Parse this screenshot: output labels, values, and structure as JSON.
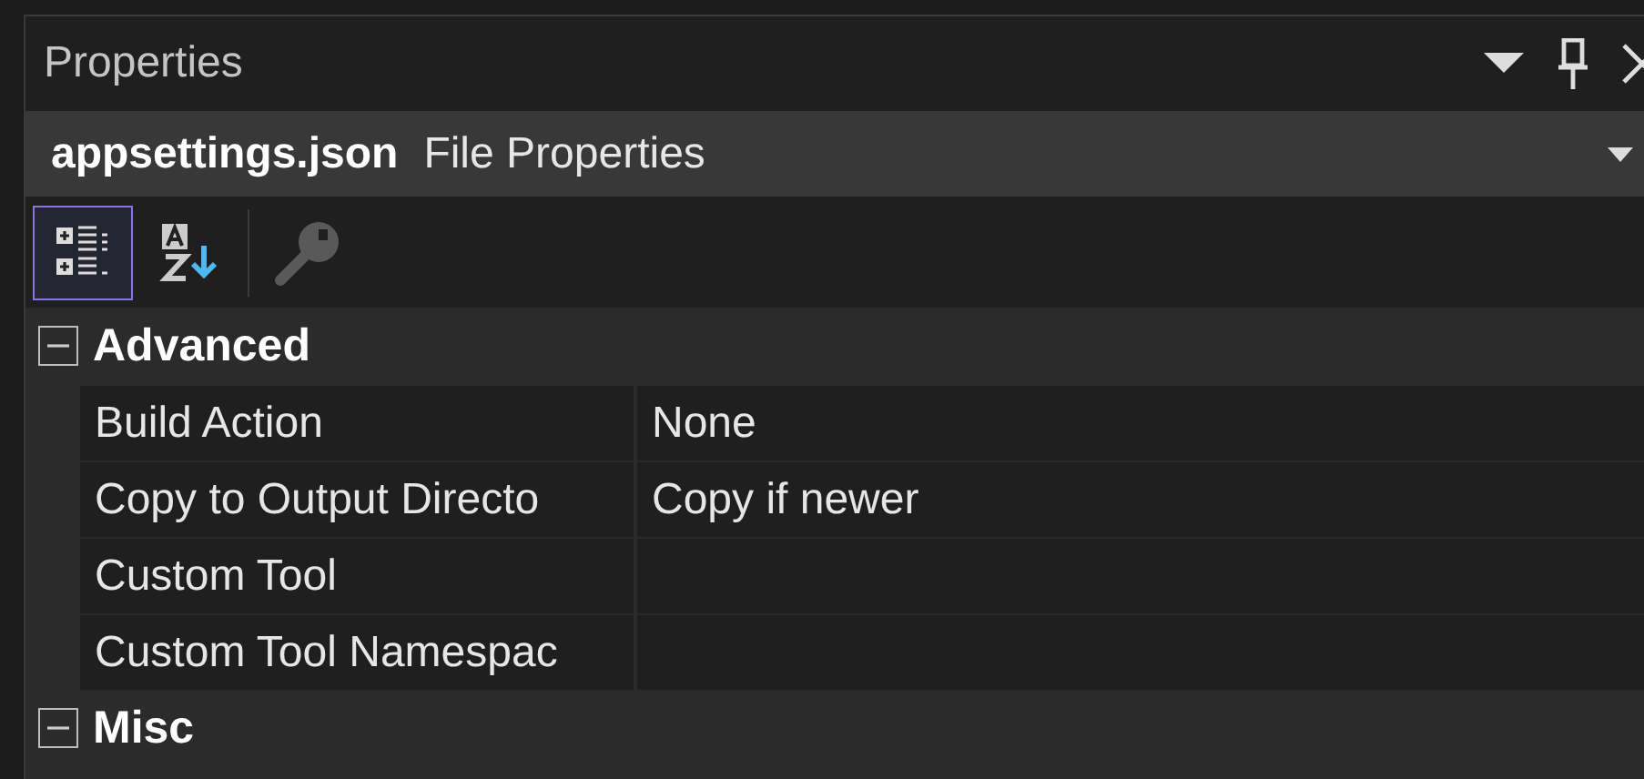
{
  "window": {
    "title": "Properties"
  },
  "object_selector": {
    "name": "appsettings.json",
    "type": "File Properties"
  },
  "toolbar": [
    {
      "kind": "categorized",
      "selected": true,
      "disabled": false
    },
    {
      "kind": "alphabetical",
      "selected": false,
      "disabled": false
    },
    {
      "kind": "property_pages",
      "selected": false,
      "disabled": true
    }
  ],
  "categories": [
    {
      "name": "Advanced",
      "expanded": true,
      "properties": [
        {
          "name": "Build Action",
          "value": "None"
        },
        {
          "name": "Copy to Output Directo",
          "value": "Copy if newer"
        },
        {
          "name": "Custom Tool"
        },
        {
          "name": "Custom Tool Namespac"
        }
      ]
    },
    {
      "name": "Misc",
      "expanded": true
    }
  ]
}
